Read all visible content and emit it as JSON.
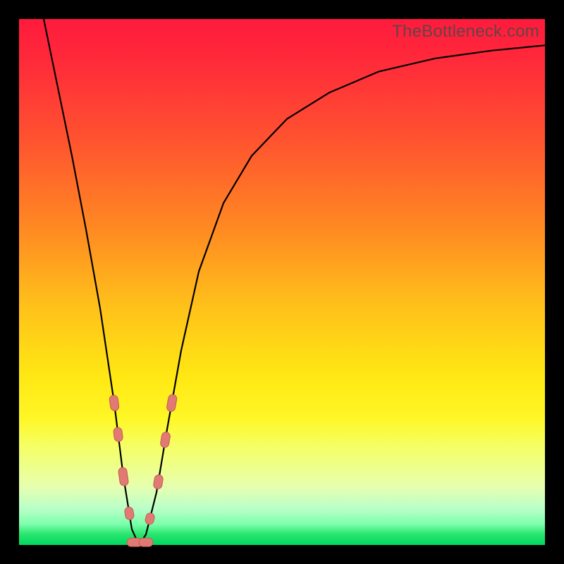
{
  "watermark": "TheBottleneck.com",
  "colors": {
    "bead_fill": "#e17a73",
    "bead_stroke": "#c15d56",
    "curve": "#000000"
  },
  "chart_data": {
    "type": "line",
    "title": "",
    "xlabel": "",
    "ylabel": "",
    "xlim": [
      0,
      746
    ],
    "ylim": [
      0,
      100
    ],
    "series": [
      {
        "name": "bottleneck-curve",
        "x": [
          35,
          55,
          75,
          95,
          115,
          135,
          148,
          160,
          170,
          180,
          195,
          210,
          230,
          255,
          290,
          330,
          380,
          440,
          510,
          590,
          670,
          746
        ],
        "y": [
          100,
          87,
          74,
          60,
          45,
          27,
          13,
          3,
          0,
          2,
          10,
          22,
          37,
          52,
          65,
          74,
          81,
          86,
          90,
          92.5,
          94,
          95
        ]
      }
    ],
    "annotations": {
      "beads": [
        {
          "side": "left",
          "y_pct": 27,
          "len": 22
        },
        {
          "side": "left",
          "y_pct": 21,
          "len": 20
        },
        {
          "side": "left",
          "y_pct": 13,
          "len": 26
        },
        {
          "side": "left",
          "y_pct": 6,
          "len": 18
        },
        {
          "side": "bottom",
          "y_pct": 0,
          "len": 22,
          "x_offset": -6
        },
        {
          "side": "bottom",
          "y_pct": 0,
          "len": 20,
          "x_offset": 10
        },
        {
          "side": "right",
          "y_pct": 5,
          "len": 16
        },
        {
          "side": "right",
          "y_pct": 12,
          "len": 20
        },
        {
          "side": "right",
          "y_pct": 20,
          "len": 22
        },
        {
          "side": "right",
          "y_pct": 27,
          "len": 24
        }
      ]
    }
  }
}
